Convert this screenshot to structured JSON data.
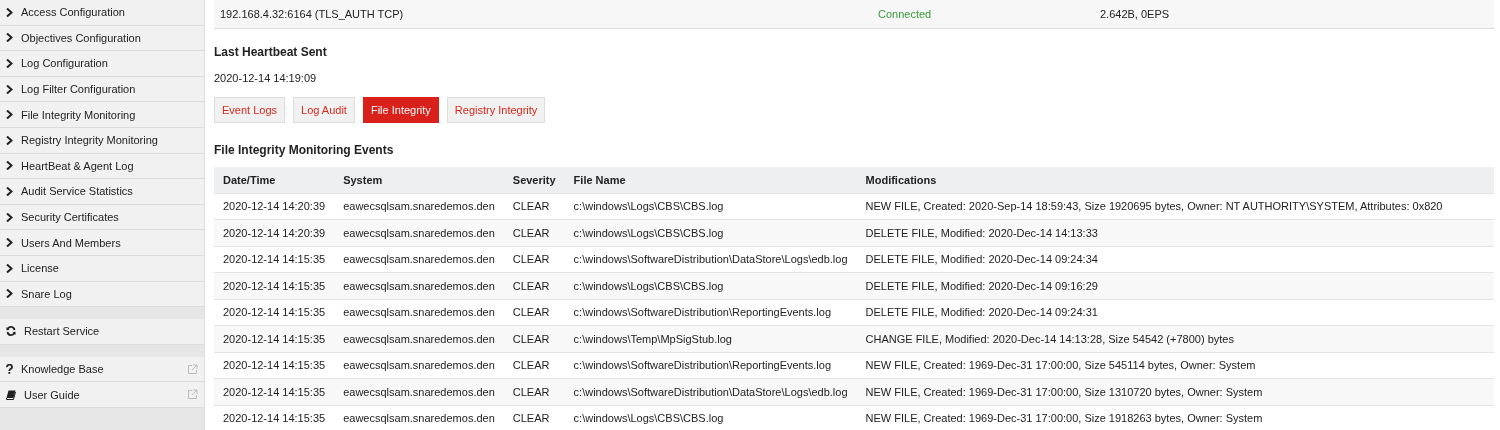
{
  "sidebar": {
    "items": [
      {
        "kind": "nav",
        "label": "Access Configuration"
      },
      {
        "kind": "nav",
        "label": "Objectives Configuration"
      },
      {
        "kind": "nav",
        "label": "Log Configuration"
      },
      {
        "kind": "nav",
        "label": "Log Filter Configuration"
      },
      {
        "kind": "nav",
        "label": "File Integrity Monitoring"
      },
      {
        "kind": "nav",
        "label": "Registry Integrity Monitoring"
      },
      {
        "kind": "nav",
        "label": "HeartBeat & Agent Log"
      },
      {
        "kind": "nav",
        "label": "Audit Service Statistics"
      },
      {
        "kind": "nav",
        "label": "Security Certificates"
      },
      {
        "kind": "nav",
        "label": "Users And Members"
      },
      {
        "kind": "nav",
        "label": "License"
      },
      {
        "kind": "nav",
        "label": "Snare Log"
      },
      {
        "kind": "action",
        "label": "Restart Service"
      },
      {
        "kind": "help",
        "label": "Knowledge Base"
      },
      {
        "kind": "guide",
        "label": "User Guide"
      }
    ]
  },
  "connection": {
    "address": "192.168.4.32:6164 (TLS_AUTH TCP)",
    "status": "Connected",
    "rate": "2.642B, 0EPS"
  },
  "heartbeat": {
    "heading": "Last Heartbeat Sent",
    "time": "2020-12-14 14:19:09"
  },
  "tabs": [
    {
      "label": "Event Logs",
      "selected": false
    },
    {
      "label": "Log Audit",
      "selected": false
    },
    {
      "label": "File Integrity",
      "selected": true
    },
    {
      "label": "Registry Integrity",
      "selected": false
    }
  ],
  "table": {
    "title": "File Integrity Monitoring Events",
    "columns": [
      "Date/Time",
      "System",
      "Severity",
      "File Name",
      "Modifications"
    ],
    "rows": [
      [
        "2020-12-14 14:20:39",
        "eawecsqlsam.snaredemos.den",
        "CLEAR",
        "c:\\windows\\Logs\\CBS\\CBS.log",
        "NEW FILE, Created: 2020-Sep-14 18:59:43, Size 1920695 bytes, Owner: NT AUTHORITY\\SYSTEM, Attributes: 0x820"
      ],
      [
        "2020-12-14 14:20:39",
        "eawecsqlsam.snaredemos.den",
        "CLEAR",
        "c:\\windows\\Logs\\CBS\\CBS.log",
        "DELETE FILE, Modified: 2020-Dec-14 14:13:33"
      ],
      [
        "2020-12-14 14:15:35",
        "eawecsqlsam.snaredemos.den",
        "CLEAR",
        "c:\\windows\\SoftwareDistribution\\DataStore\\Logs\\edb.log",
        "DELETE FILE, Modified: 2020-Dec-14 09:24:34"
      ],
      [
        "2020-12-14 14:15:35",
        "eawecsqlsam.snaredemos.den",
        "CLEAR",
        "c:\\windows\\Logs\\CBS\\CBS.log",
        "DELETE FILE, Modified: 2020-Dec-14 09:16:29"
      ],
      [
        "2020-12-14 14:15:35",
        "eawecsqlsam.snaredemos.den",
        "CLEAR",
        "c:\\windows\\SoftwareDistribution\\ReportingEvents.log",
        "DELETE FILE, Modified: 2020-Dec-14 09:24:31"
      ],
      [
        "2020-12-14 14:15:35",
        "eawecsqlsam.snaredemos.den",
        "CLEAR",
        "c:\\windows\\Temp\\MpSigStub.log",
        "CHANGE FILE, Modified: 2020-Dec-14 14:13:28, Size 54542 (+7800) bytes"
      ],
      [
        "2020-12-14 14:15:35",
        "eawecsqlsam.snaredemos.den",
        "CLEAR",
        "c:\\windows\\SoftwareDistribution\\ReportingEvents.log",
        "NEW FILE, Created: 1969-Dec-31 17:00:00, Size 545114 bytes, Owner: System"
      ],
      [
        "2020-12-14 14:15:35",
        "eawecsqlsam.snaredemos.den",
        "CLEAR",
        "c:\\windows\\SoftwareDistribution\\DataStore\\Logs\\edb.log",
        "NEW FILE, Created: 1969-Dec-31 17:00:00, Size 1310720 bytes, Owner: System"
      ],
      [
        "2020-12-14 14:15:35",
        "eawecsqlsam.snaredemos.den",
        "CLEAR",
        "c:\\windows\\Logs\\CBS\\CBS.log",
        "NEW FILE, Created: 1969-Dec-31 17:00:00, Size 1918263 bytes, Owner: System"
      ]
    ]
  }
}
